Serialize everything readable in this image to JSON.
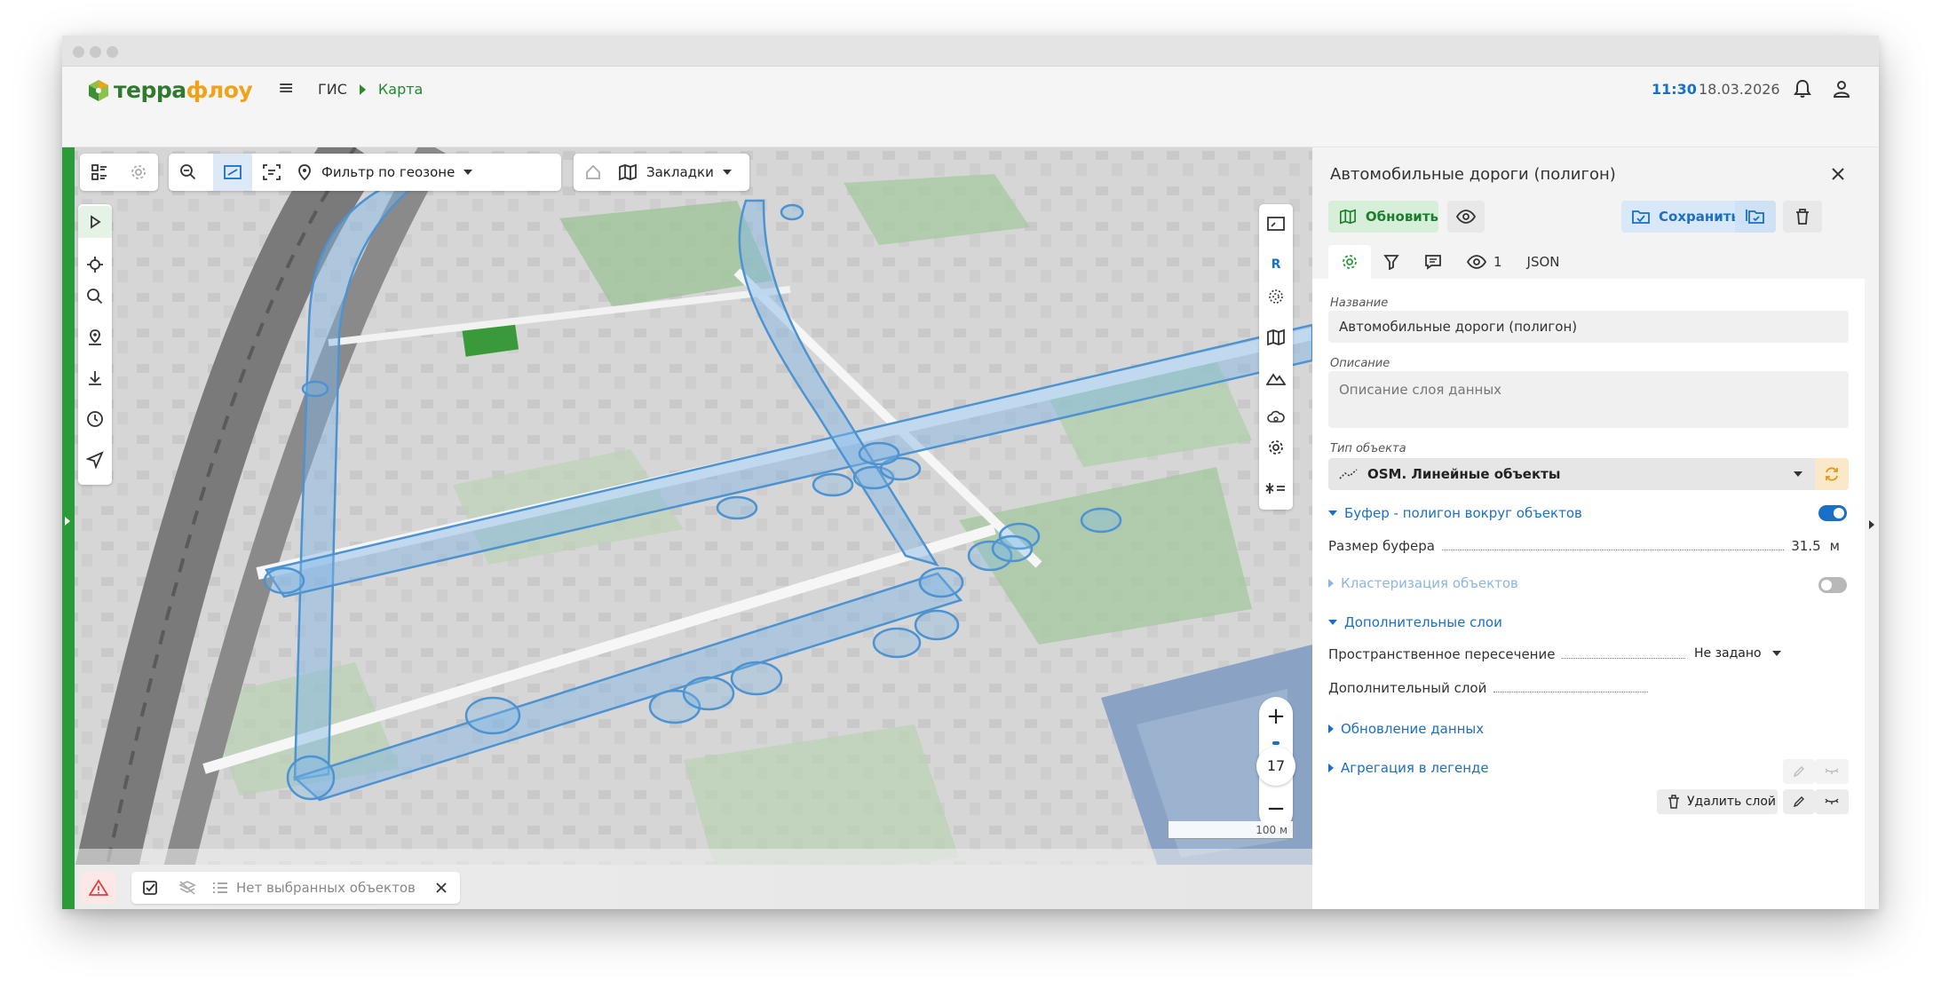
{
  "app": {
    "logo_prefix": "терра",
    "logo_suffix": "флоу"
  },
  "header": {
    "breadcrumb": [
      "ГИС",
      "Карта"
    ],
    "time": "11:30",
    "date": "18.03.2026"
  },
  "map_toolbar": {
    "geozone_filter_label": "Фильтр по геозоне",
    "bookmarks_label": "Закладки"
  },
  "map": {
    "right_tools_r_label": "R",
    "zoom_level": "17",
    "zoom_in": "+",
    "zoom_out": "−",
    "scale_label": "100 м"
  },
  "bottom_bar": {
    "selection_text": "Нет выбранных объектов"
  },
  "panel": {
    "title": "Автомобильные дороги (полигон)",
    "refresh_label": "Обновить",
    "save_label": "Сохранить",
    "tabs": {
      "visible_count": "1",
      "json_label": "JSON"
    },
    "name_label": "Название",
    "name_value": "Автомобильные дороги (полигон)",
    "description_label": "Описание",
    "description_placeholder": "Описание слоя данных",
    "object_type_label": "Тип объекта",
    "object_type_value": "OSM. Линейные объекты",
    "buffer_section": "Буфер - полигон вокруг объектов",
    "buffer_enabled": true,
    "buffer_size_label": "Размер буфера",
    "buffer_size_value": "31.5",
    "buffer_size_unit": "м",
    "clustering_section": "Кластеризация объектов",
    "clustering_enabled": false,
    "extra_layers_section": "Дополнительные слои",
    "spatial_intersection_label": "Пространственное пересечение",
    "spatial_intersection_value": "Не задано",
    "extra_layer_label": "Дополнительный слой",
    "delete_layer_label": "Удалить слой",
    "data_update_section": "Обновление данных",
    "legend_aggregation_section": "Агрегация в легенде"
  },
  "colors": {
    "brand_green": "#2f7a2f",
    "brand_orange": "#f1a21b",
    "accent_blue": "#1a6fc6",
    "buffer_fill": "#7fb6e6"
  }
}
